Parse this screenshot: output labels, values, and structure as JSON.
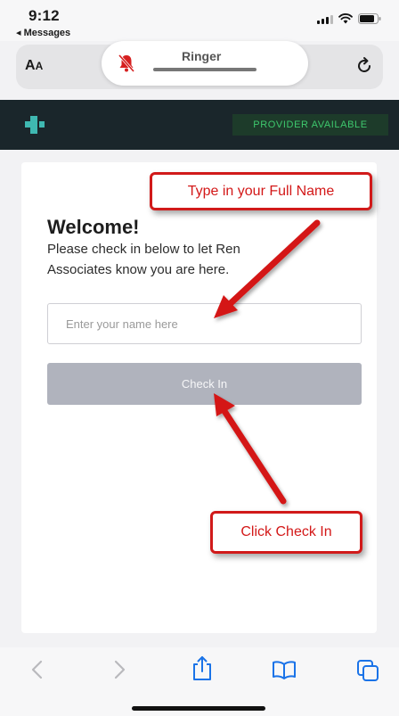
{
  "status_bar": {
    "time": "9:12",
    "back_app": "◂ Messages"
  },
  "browser": {
    "text_size": {
      "big": "A",
      "small": "A"
    },
    "ringer_label": "Ringer"
  },
  "header": {
    "provider_status": "PROVIDER AVAILABLE"
  },
  "checkin": {
    "title": "Welcome!",
    "intro_line1": "Please check in below to let Ren",
    "intro_line2": "Associates know you are here.",
    "name_placeholder": "Enter your name here",
    "button_label": "Check In"
  },
  "annotations": {
    "name_hint": "Type in your Full Name",
    "button_hint": "Click Check In"
  },
  "colors": {
    "header_bg": "#1a262b",
    "badge_text": "#3ec86d",
    "logo": "#3fb8b1",
    "button_bg": "#b0b3bd",
    "annotation_red": "#d11a1a",
    "toolbar_active": "#1a73e8"
  },
  "icons": {
    "logo": "medical-cross-icon",
    "bell": "bell-muted-icon",
    "reload": "reload-icon",
    "back": "chevron-left-icon",
    "forward": "chevron-right-icon",
    "share": "share-icon",
    "bookmarks": "book-icon",
    "tabs": "tabs-icon"
  }
}
